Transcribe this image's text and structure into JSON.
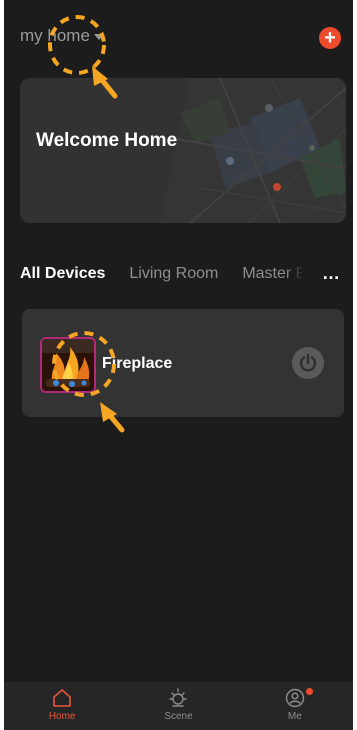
{
  "header": {
    "home_name": "my home",
    "add_icon": "plus-icon"
  },
  "welcome": {
    "title": "Welcome Home"
  },
  "tabs": [
    {
      "label": "All Devices",
      "active": true
    },
    {
      "label": "Living Room",
      "active": false
    },
    {
      "label": "Master Bedroom",
      "active": false
    }
  ],
  "more_icon": "…",
  "devices": [
    {
      "name": "Fireplace",
      "icon": "fireplace-thumbnail",
      "power_icon": "power-icon"
    }
  ],
  "bottom_nav": [
    {
      "label": "Home",
      "icon": "house-icon",
      "active": true
    },
    {
      "label": "Scene",
      "icon": "sun-icon",
      "active": false
    },
    {
      "label": "Me",
      "icon": "profile-icon",
      "active": false,
      "badge": true
    }
  ],
  "colors": {
    "accent": "#ee4a2b",
    "background": "#1c1c1c",
    "card": "#333333",
    "annotation": "#f5a623"
  }
}
